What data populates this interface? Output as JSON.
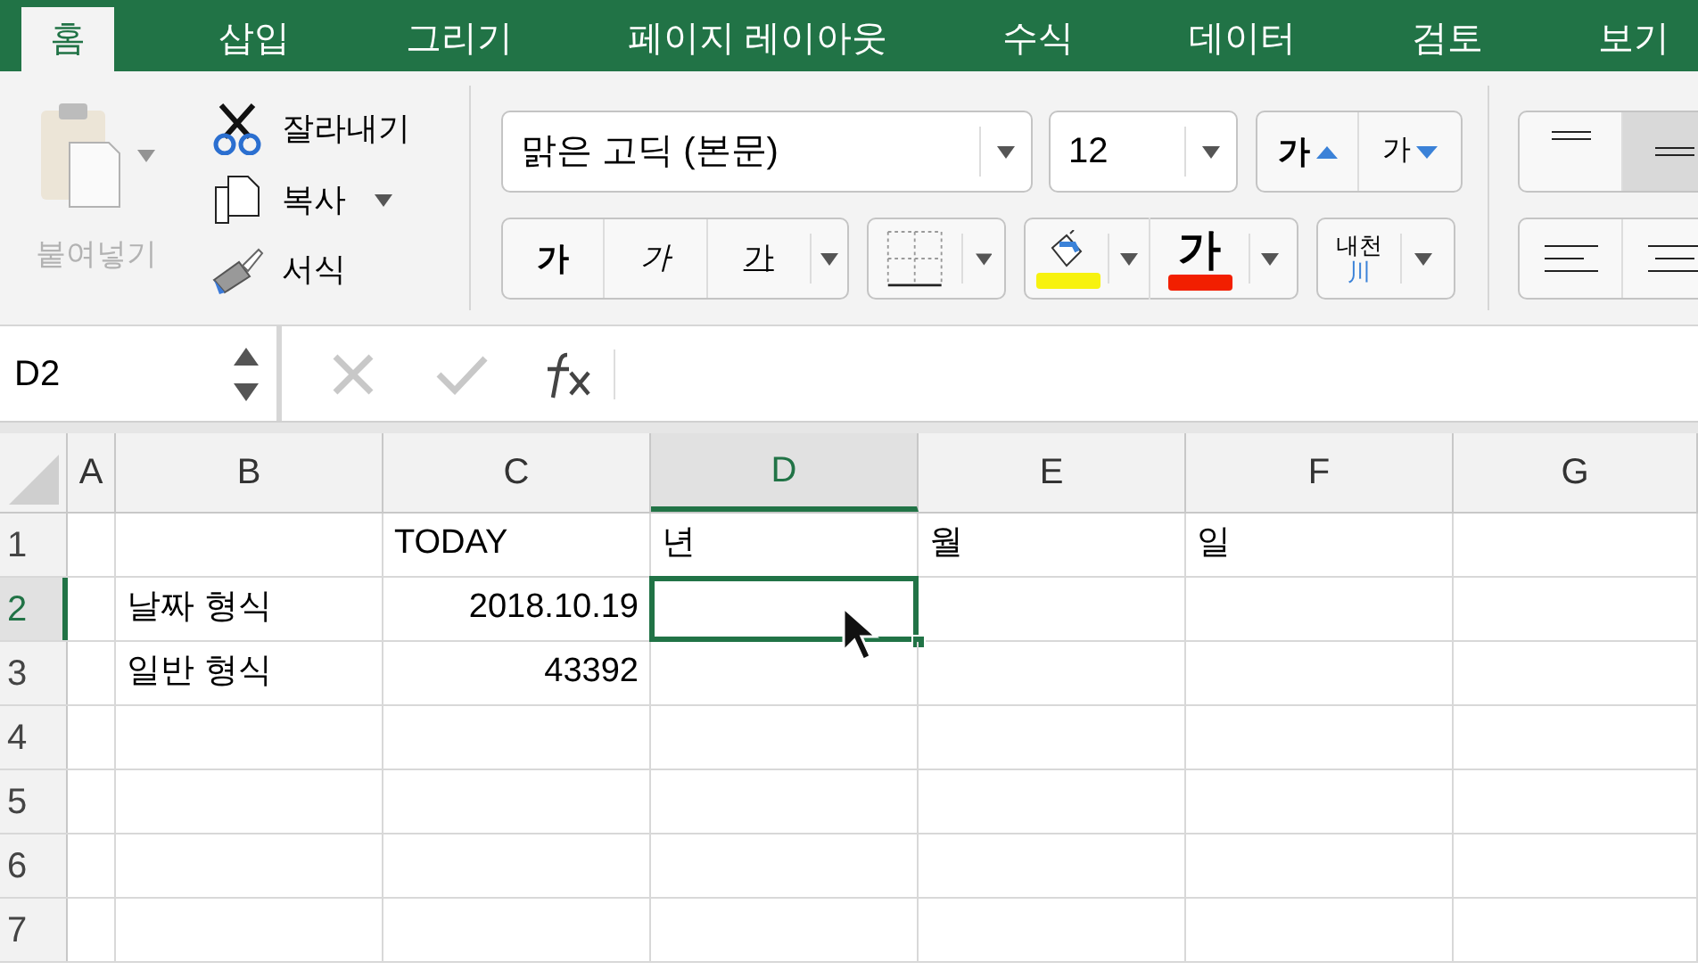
{
  "tabs": [
    {
      "label": "홈",
      "selected": true
    },
    {
      "label": "삽입",
      "selected": false
    },
    {
      "label": "그리기",
      "selected": false
    },
    {
      "label": "페이지 레이아웃",
      "selected": false
    },
    {
      "label": "수식",
      "selected": false
    },
    {
      "label": "데이터",
      "selected": false
    },
    {
      "label": "검토",
      "selected": false
    },
    {
      "label": "보기",
      "selected": false
    }
  ],
  "clipboard": {
    "paste": {
      "label": "붙여넣기",
      "disabled": true
    },
    "cut": "잘라내기",
    "copy": "복사",
    "format_painter": "서식"
  },
  "font": {
    "name": "맑은 고딕 (본문)",
    "size": "12",
    "grow": "가",
    "shrink": "가",
    "bold": "가",
    "italic": "가",
    "underline": "가",
    "font_color_glyph": "가",
    "phonetic_top": "내천",
    "phonetic_bottom": "川"
  },
  "name_box": "D2",
  "columns": [
    {
      "label": "A",
      "selected": false
    },
    {
      "label": "B",
      "selected": false
    },
    {
      "label": "C",
      "selected": false
    },
    {
      "label": "D",
      "selected": true
    },
    {
      "label": "E",
      "selected": false
    },
    {
      "label": "F",
      "selected": false
    },
    {
      "label": "G",
      "selected": false
    }
  ],
  "rows": [
    {
      "header": "1",
      "selected": false,
      "C": {
        "kind": "text",
        "text": "TODAY"
      },
      "D": {
        "kind": "text",
        "text": "년"
      },
      "E": {
        "kind": "text",
        "text": "월"
      },
      "F": {
        "kind": "text",
        "text": "일"
      }
    },
    {
      "header": "2",
      "selected": true,
      "B": {
        "kind": "text",
        "text": "날짜 형식"
      },
      "C": {
        "kind": "number",
        "text": "2018.10.19"
      }
    },
    {
      "header": "3",
      "selected": false,
      "B": {
        "kind": "text",
        "text": "일반 형식"
      },
      "C": {
        "kind": "number",
        "text": "43392"
      }
    },
    {
      "header": "4",
      "selected": false
    },
    {
      "header": "5",
      "selected": false
    },
    {
      "header": "6",
      "selected": false
    },
    {
      "header": "7",
      "selected": false
    }
  ]
}
